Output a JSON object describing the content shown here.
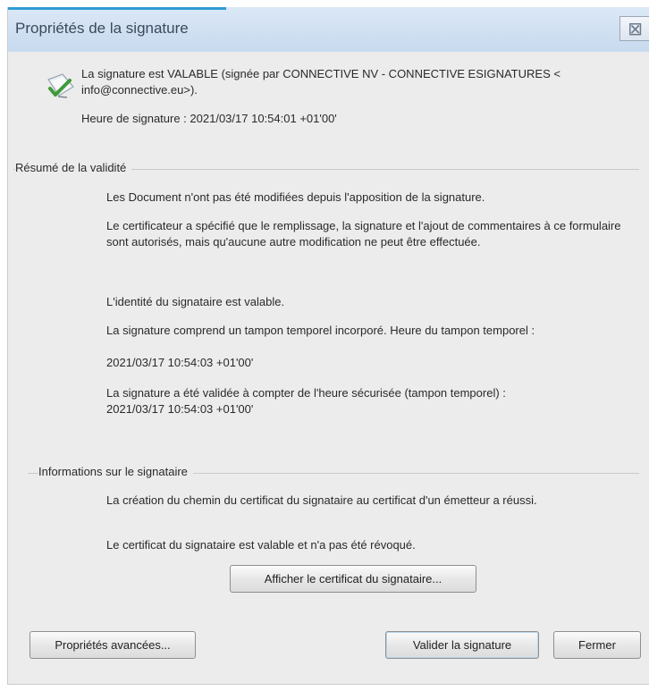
{
  "window": {
    "title": "Propriétés de la signature",
    "close_glyph": "⊠"
  },
  "status": {
    "text": "La signature est VALABLE (signée par CONNECTIVE NV - CONNECTIVE ESIGNATURES < info@connective.eu>).",
    "time_label": "Heure de signature :",
    "time_value": "2021/03/17 10:54:01 +01'00'"
  },
  "validity_summary": {
    "title": "Résumé de la validité",
    "items": [
      "Les Document n'ont pas été modifiées depuis l'apposition de la signature.",
      "Le certificateur a spécifié que le remplissage, la signature et l'ajout de commentaires à ce formulaire sont autorisés, mais qu'aucune autre modification ne peut être effectuée.",
      "L'identité du signataire est valable.",
      "La signature comprend un tampon temporel incorporé. Heure du tampon temporel :",
      "2021/03/17 10:54:03 +01'00'",
      "La signature a été validée à compter de l'heure sécurisée (tampon temporel) :",
      "2021/03/17 10:54:03 +01'00'"
    ]
  },
  "signer_info": {
    "title": "Informations sur le signataire",
    "items": [
      "La création du chemin du certificat du signataire au certificat d'un émetteur a réussi.",
      "Le certificat du signataire est valable et n'a pas été révoqué."
    ],
    "show_certificate_label": "Afficher le certificat du signataire..."
  },
  "footer": {
    "advanced_label": "Propriétés avancées...",
    "validate_label": "Valider la signature",
    "close_label": "Fermer"
  }
}
